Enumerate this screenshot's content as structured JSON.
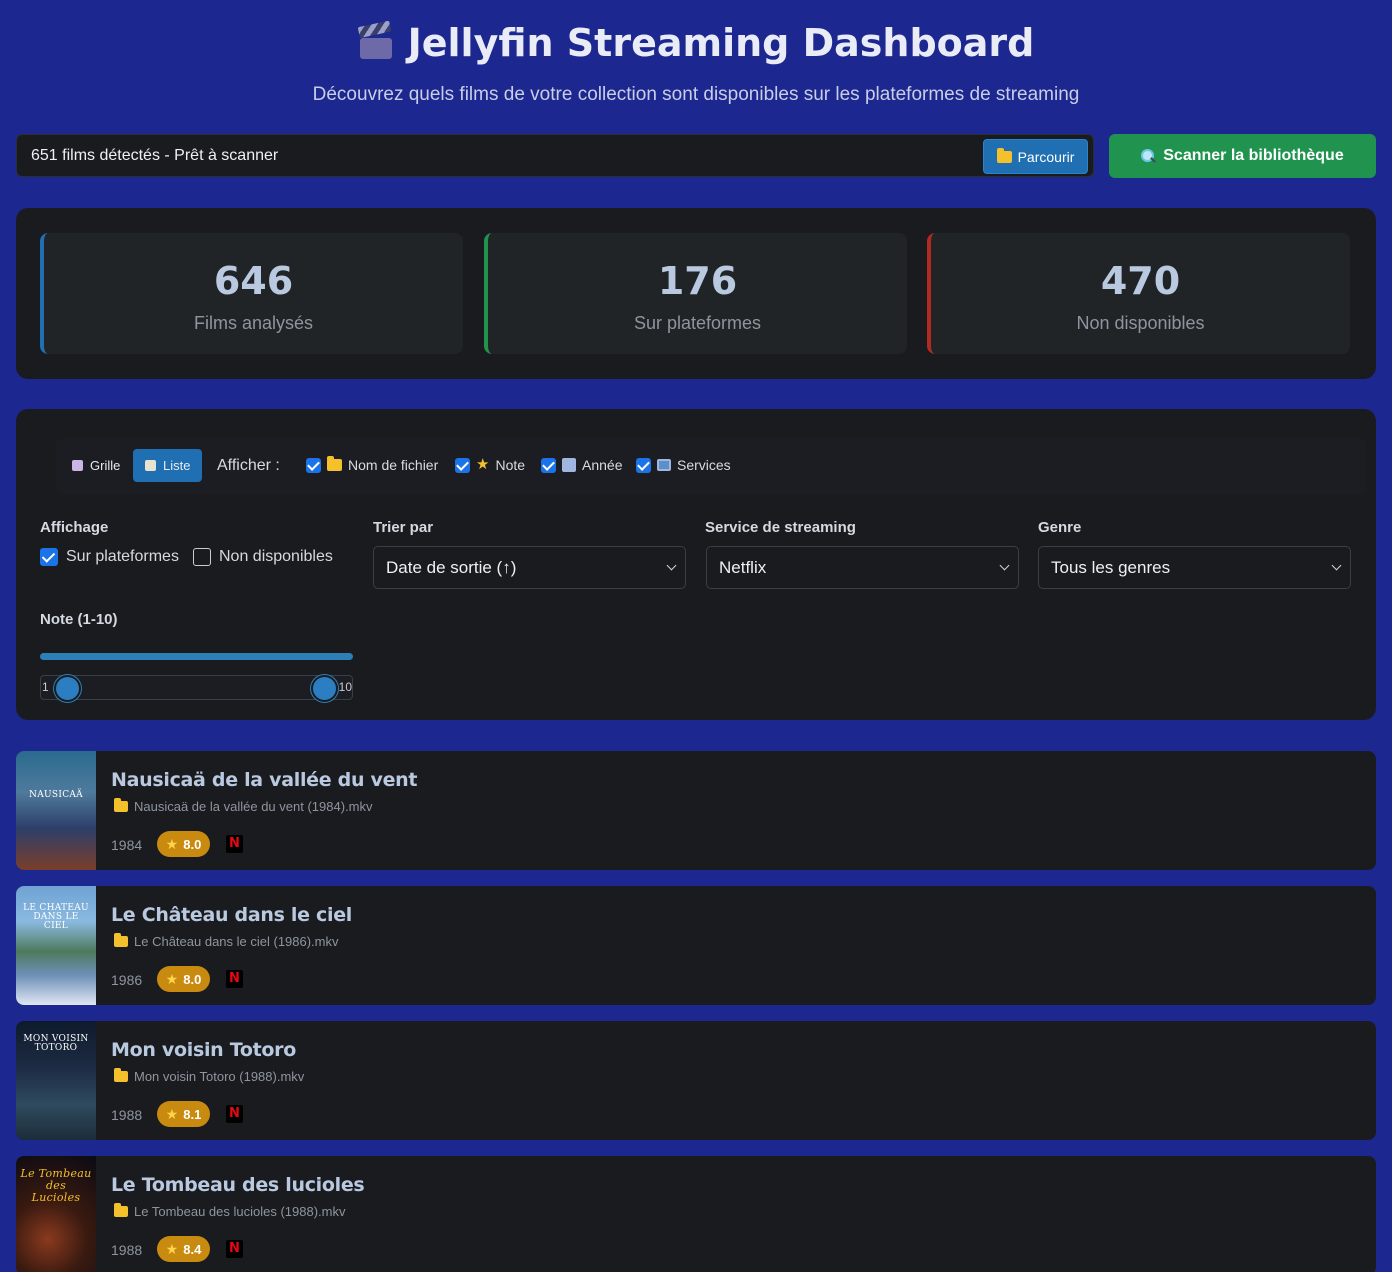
{
  "header": {
    "title": "Jellyfin Streaming Dashboard",
    "subtitle": "Découvrez quels films de votre collection sont disponibles sur les plateformes de streaming",
    "icon": "clapperboard-icon"
  },
  "scan": {
    "status": "651 films détectés - Prêt à scanner",
    "browse_label": "Parcourir",
    "scan_label": "Scanner la bibliothèque"
  },
  "stats": [
    {
      "value": "646",
      "label": "Films analysés",
      "color": "#1f6fb2"
    },
    {
      "value": "176",
      "label": "Sur plateformes",
      "color": "#20944f"
    },
    {
      "value": "470",
      "label": "Non disponibles",
      "color": "#b02a22"
    }
  ],
  "view": {
    "grid_label": "Grille",
    "list_label": "Liste",
    "active": "list",
    "show_label": "Afficher :",
    "options": [
      {
        "label": "Nom de fichier",
        "checked": true,
        "icon": "folder-icon"
      },
      {
        "label": "Note",
        "checked": true,
        "icon": "star-icon"
      },
      {
        "label": "Année",
        "checked": true,
        "icon": "calendar-icon"
      },
      {
        "label": "Services",
        "checked": true,
        "icon": "tv-icon"
      }
    ]
  },
  "filters": {
    "display_label": "Affichage",
    "on_platforms_label": "Sur plateformes",
    "on_platforms_checked": true,
    "unavailable_label": "Non disponibles",
    "unavailable_checked": false,
    "sort_label": "Trier par",
    "sort_value": "Date de sortie (↑)",
    "service_label": "Service de streaming",
    "service_value": "Netflix",
    "genre_label": "Genre",
    "genre_value": "Tous les genres",
    "rating_label": "Note (1-10)",
    "rating_min": "1",
    "rating_max": "10"
  },
  "movies": [
    {
      "title": "Nausicaä de la vallée du vent",
      "file": "Nausicaä de la vallée du vent (1984).mkv",
      "year": "1984",
      "rating": "8.0",
      "service": "N",
      "poster_text": "NAUSICAÄ"
    },
    {
      "title": "Le Château dans le ciel",
      "file": "Le Château dans le ciel (1986).mkv",
      "year": "1986",
      "rating": "8.0",
      "service": "N",
      "poster_text": "LE CHATEAU DANS LE CIEL"
    },
    {
      "title": "Mon voisin Totoro",
      "file": "Mon voisin Totoro (1988).mkv",
      "year": "1988",
      "rating": "8.1",
      "service": "N",
      "poster_text": "MON VOISIN TOTORO"
    },
    {
      "title": "Le Tombeau des lucioles",
      "file": "Le Tombeau des lucioles (1988).mkv",
      "year": "1988",
      "rating": "8.4",
      "service": "N",
      "poster_text": "Le Tombeau des Lucioles"
    }
  ]
}
